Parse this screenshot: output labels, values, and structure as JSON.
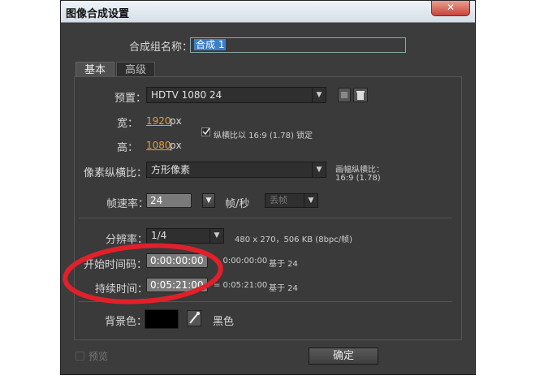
{
  "window": {
    "title": "图像合成设置",
    "close_glyph": "✕"
  },
  "comp_name": {
    "label": "合成组名称：",
    "value": "合成 1"
  },
  "tabs": [
    {
      "label": "基本"
    },
    {
      "label": "高级"
    }
  ],
  "preset": {
    "label": "预置：",
    "value": "HDTV 1080 24"
  },
  "width": {
    "label": "宽：",
    "value": "1920",
    "unit": "px"
  },
  "height": {
    "label": "高：",
    "value": "1080",
    "unit": "px"
  },
  "lock_aspect": {
    "checked": true,
    "label": "纵横比以 16:9 (1.78) 锁定"
  },
  "pixel_aspect": {
    "label": "像素纵横比：",
    "value": "方形像素",
    "frame_aspect_label": "画幅纵横比：",
    "frame_aspect_value": "16:9 (1.78)"
  },
  "frame_rate": {
    "label": "帧速率：",
    "value": "24",
    "unit": "帧/秒",
    "drop_frame": "丢帧"
  },
  "resolution": {
    "label": "分辨率：",
    "value": "1/4",
    "info": "480 x 270，506 KB (8bpc/帧)"
  },
  "start_timecode": {
    "label": "开始时间码：",
    "value": "0:00:00:00",
    "info_prefix": "= 0:00:00:00",
    "info_suffix": "基于 24"
  },
  "duration": {
    "label": "持续时间：",
    "value": "0:05:21:00",
    "info_prefix": "= 0:05:21:00",
    "info_suffix": "基于 24"
  },
  "background": {
    "label": "背景色：",
    "color_name": "黑色",
    "color": "#000000"
  },
  "preview": {
    "label": "预览"
  },
  "ok_button": {
    "label": "确定"
  },
  "annotation_color": "#e0202a"
}
